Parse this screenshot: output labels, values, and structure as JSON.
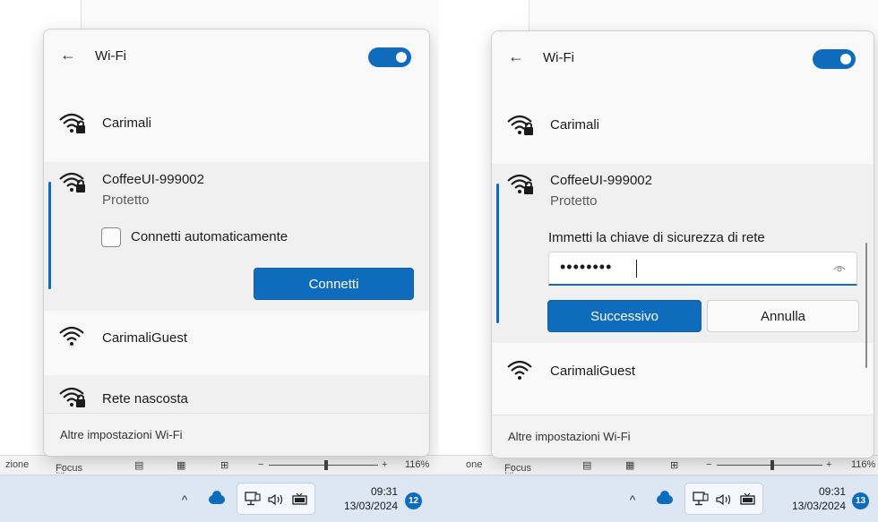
{
  "left": {
    "wifi": {
      "title": "Wi-Fi",
      "toggle_on": true,
      "networks": [
        {
          "name": "Carimali",
          "secured": true
        },
        {
          "name": "CoffeeUI-999002",
          "status": "Protetto",
          "secured": true,
          "expanded": true
        },
        {
          "name": "CarimaliGuest",
          "secured": false
        },
        {
          "name": "Rete nascosta",
          "secured": true
        }
      ],
      "auto_connect_label": "Connetti automaticamente",
      "connect_button": "Connetti",
      "more_settings": "Altre impostazioni Wi-Fi"
    },
    "statusbar": {
      "left_text": "zione",
      "focus_label": "Focus",
      "zoom_text": "116%"
    },
    "taskbar": {
      "time": "09:31",
      "date": "13/03/2024",
      "badge": "12"
    }
  },
  "right": {
    "wifi": {
      "title": "Wi-Fi",
      "toggle_on": true,
      "networks": [
        {
          "name": "Carimali",
          "secured": true
        },
        {
          "name": "CoffeeUI-999002",
          "status": "Protetto",
          "secured": true,
          "expanded": true
        },
        {
          "name": "CarimaliGuest",
          "secured": false
        }
      ],
      "key_label": "Immetti la chiave di sicurezza di rete",
      "password_mask": "••••••••",
      "next_button": "Successivo",
      "cancel_button": "Annulla",
      "more_settings": "Altre impostazioni Wi-Fi"
    },
    "statusbar": {
      "left_text": "one",
      "focus_label": "Focus",
      "zoom_text": "116%"
    },
    "taskbar": {
      "time": "09:31",
      "date": "13/03/2024",
      "badge": "13"
    }
  },
  "colors": {
    "accent": "#0f6cbd",
    "taskbar": "#dde6f3",
    "flyout_bg": "#f9f9f9"
  },
  "icons": [
    "back-arrow-icon",
    "wifi-lock-icon",
    "wifi-icon",
    "chevron-up-icon",
    "onedrive-cloud-icon",
    "network-icon",
    "volume-icon",
    "battery-icon",
    "eye-icon"
  ]
}
